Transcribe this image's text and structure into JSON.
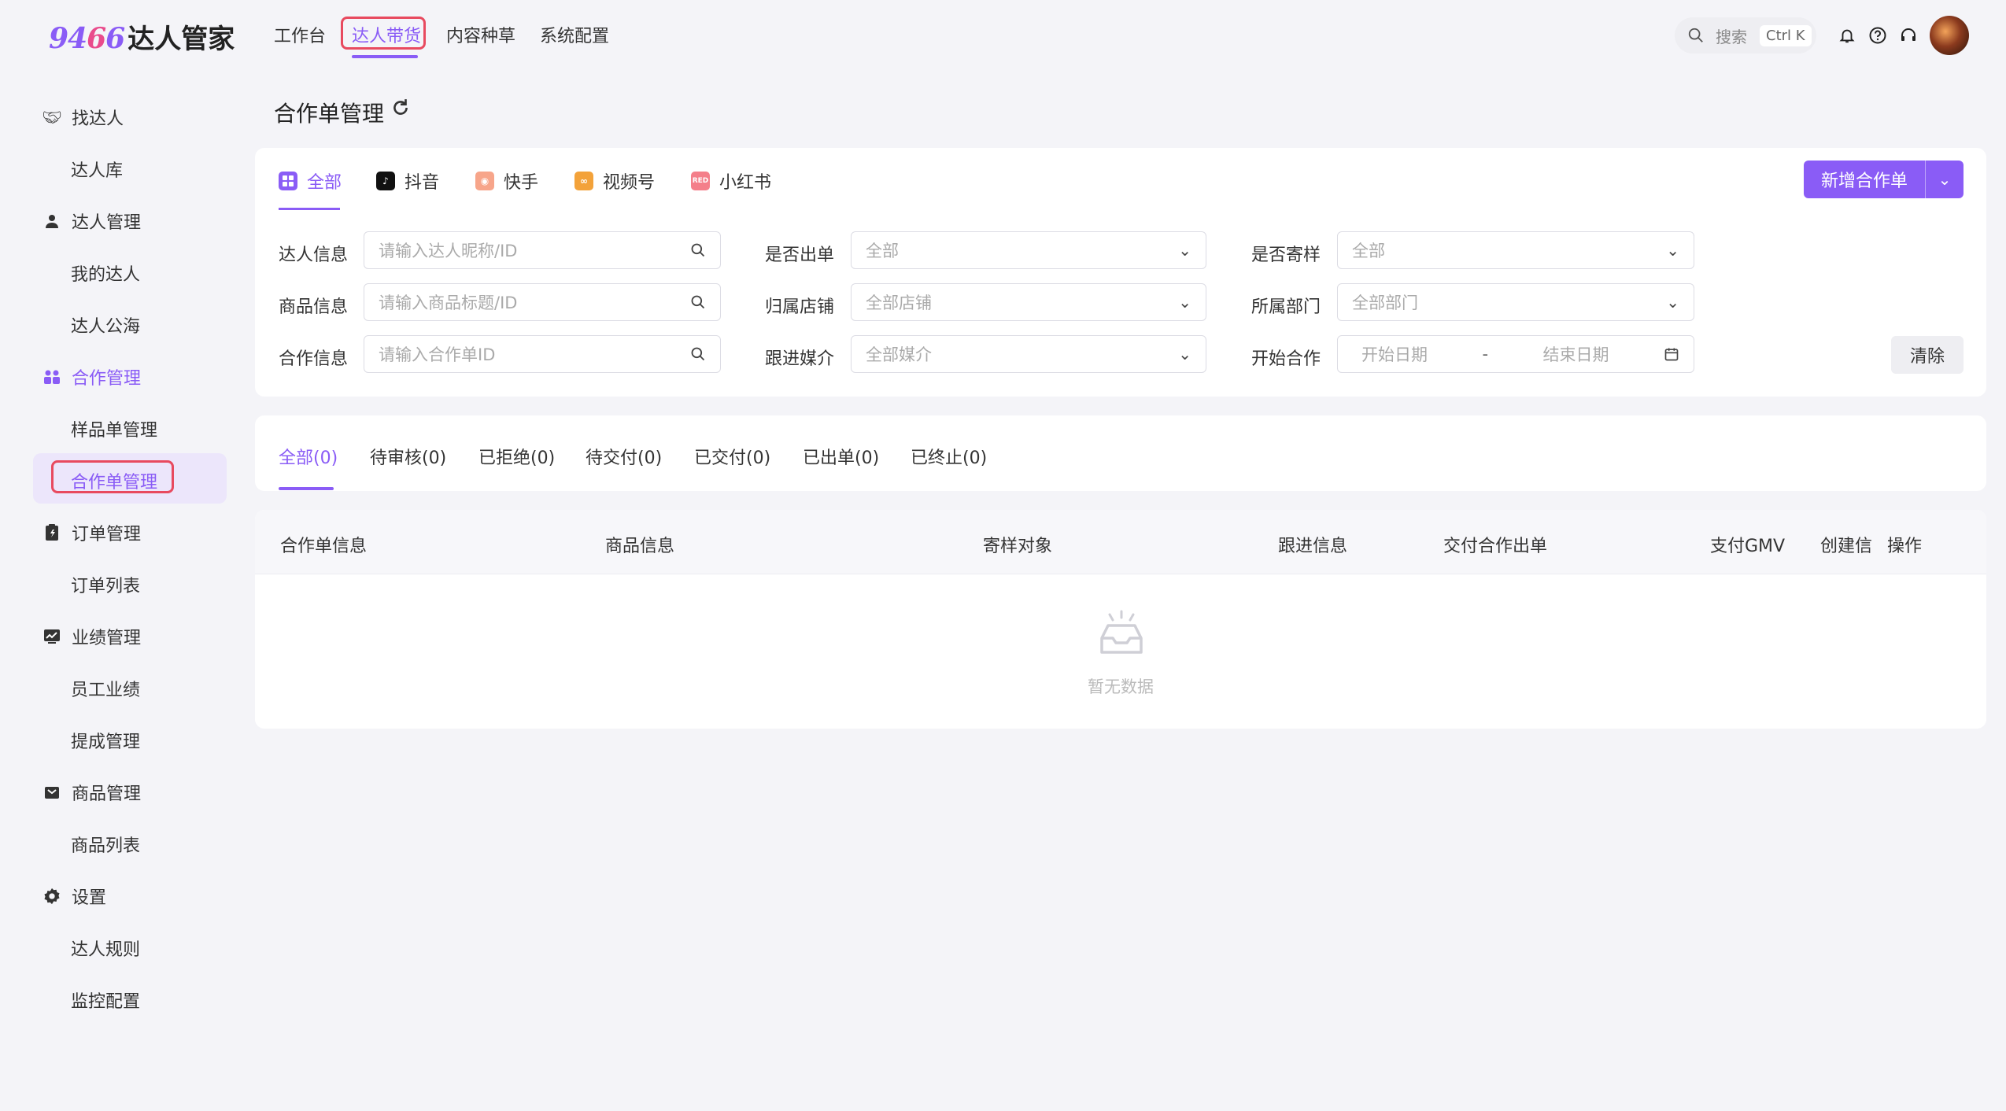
{
  "app": {
    "logo_number_a": "94",
    "logo_number_b": "6",
    "logo_number_c": "6",
    "logo_text": "达人管家"
  },
  "topnav": [
    "工作台",
    "达人带货",
    "内容种草",
    "系统配置"
  ],
  "search": {
    "label": "搜索",
    "shortcut": "Ctrl K"
  },
  "top_icons": [
    "bell-icon",
    "help-icon",
    "headset-icon"
  ],
  "sidebar": {
    "groups": [
      {
        "label": "找达人",
        "icon": "handshake-icon",
        "items": [
          "达人库"
        ]
      },
      {
        "label": "达人管理",
        "icon": "user-icon",
        "items": [
          "我的达人",
          "达人公海"
        ]
      },
      {
        "label": "合作管理",
        "icon": "people-icon",
        "items": [
          "样品单管理",
          "合作单管理"
        ]
      },
      {
        "label": "订单管理",
        "icon": "order-icon",
        "items": [
          "订单列表"
        ]
      },
      {
        "label": "业绩管理",
        "icon": "chart-icon",
        "items": [
          "员工业绩",
          "提成管理"
        ]
      },
      {
        "label": "商品管理",
        "icon": "box-icon",
        "items": [
          "商品列表"
        ]
      },
      {
        "label": "设置",
        "icon": "gear-icon",
        "items": [
          "达人规则",
          "监控配置"
        ]
      }
    ],
    "selected": "合作单管理"
  },
  "page": {
    "title": "合作单管理"
  },
  "platform_tabs": [
    "全部",
    "抖音",
    "快手",
    "视频号",
    "小红书"
  ],
  "new_button": {
    "label": "新增合作单"
  },
  "filters": {
    "talent_info": {
      "label": "达人信息",
      "placeholder": "请输入达人昵称/ID"
    },
    "product_info": {
      "label": "商品信息",
      "placeholder": "请输入商品标题/ID"
    },
    "coop_info": {
      "label": "合作信息",
      "placeholder": "请输入合作单ID"
    },
    "has_order": {
      "label": "是否出单",
      "value": "全部"
    },
    "store": {
      "label": "归属店铺",
      "value": "全部店铺"
    },
    "media": {
      "label": "跟进媒介",
      "value": "全部媒介"
    },
    "sample": {
      "label": "是否寄样",
      "value": "全部"
    },
    "dept": {
      "label": "所属部门",
      "value": "全部部门"
    },
    "start_coop": {
      "label": "开始合作",
      "start": "开始日期",
      "sep": "-",
      "end": "结束日期"
    },
    "clear_label": "清除"
  },
  "status_tabs": [
    "全部(0)",
    "待审核(0)",
    "已拒绝(0)",
    "待交付(0)",
    "已交付(0)",
    "已出单(0)",
    "已终止(0)"
  ],
  "table": {
    "columns": [
      "合作单信息",
      "商品信息",
      "寄样对象",
      "跟进信息",
      "交付合作出单",
      "支付GMV",
      "创建信",
      "操作"
    ],
    "empty_text": "暂无数据"
  },
  "colors": {
    "accent": "#8a5cf6",
    "highlight_box": "#e84a5f"
  }
}
